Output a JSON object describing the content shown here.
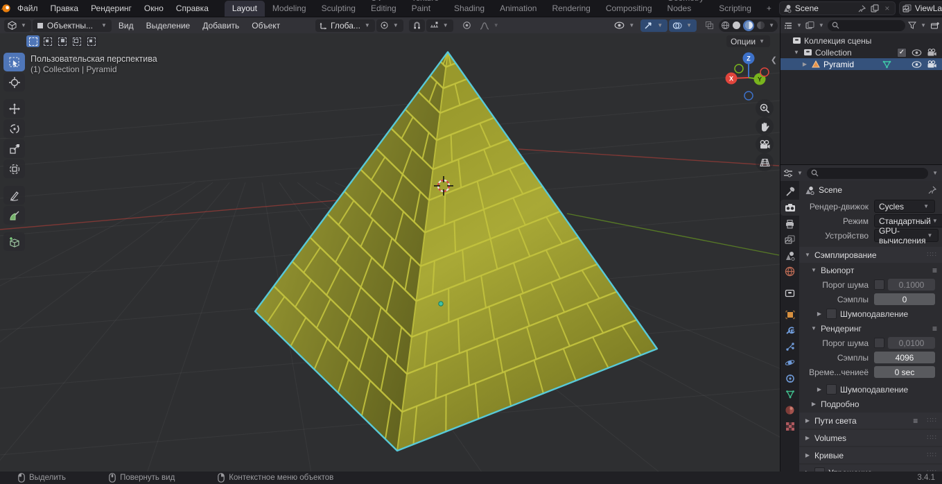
{
  "colors": {
    "accent": "#4f76b8",
    "selection_outline": "#58c9d8",
    "pyramid_mortar": "#c2c23e",
    "axis_x": "#e0453c",
    "axis_y": "#79b41e",
    "axis_z": "#3d71c9",
    "origin_dot": "#41c2a6"
  },
  "topbar": {
    "menus": [
      "Файл",
      "Правка",
      "Рендеринг",
      "Окно",
      "Справка"
    ],
    "tabs": [
      "Layout",
      "Modeling",
      "Sculpting",
      "UV Editing",
      "Texture Paint",
      "Shading",
      "Animation",
      "Rendering",
      "Compositing",
      "Geometry Nodes",
      "Scripting",
      "+"
    ],
    "active_tab": "Layout",
    "scene": "Scene",
    "viewlayer": "ViewLayer"
  },
  "header": {
    "mode": "Объектны...",
    "menus": [
      "Вид",
      "Выделение",
      "Добавить",
      "Объект"
    ],
    "orientation": "Глоба...",
    "options": "Опции"
  },
  "viewport": {
    "view_label": "Пользовательская перспектива",
    "context_label": "(1) Collection | Pyramid",
    "gizmo_axes": [
      "X",
      "Y",
      "Z"
    ]
  },
  "outliner": {
    "root_label": "Коллекция сцены",
    "collection_label": "Collection",
    "object_label": "Pyramid"
  },
  "properties": {
    "breadcrumb": "Scene",
    "render_engine_label": "Рендер-движок",
    "render_engine": "Cycles",
    "feature_set_label": "Режим",
    "feature_set": "Стандартный",
    "device_label": "Устройство",
    "device": "GPU-вычисления",
    "sampling": {
      "title": "Сэмплирование",
      "viewport": {
        "title": "Вьюпорт",
        "noise_label": "Порог шума",
        "noise_value": "0.1000",
        "samples_label": "Сэмплы",
        "samples_value": "0",
        "denoise_label": "Шумоподавление"
      },
      "render": {
        "title": "Рендеринг",
        "noise_label": "Порог шума",
        "noise_value": "0,0100",
        "samples_label": "Сэмплы",
        "samples_value": "4096",
        "time_label": "Време...чениеё",
        "time_value": "0 sec",
        "denoise_label": "Шумоподавление"
      },
      "advanced_label": "Подробно"
    },
    "sections": [
      "Пути света",
      "Volumes",
      "Кривые",
      "Упрощение"
    ]
  },
  "statusbar": {
    "items": [
      "Выделить",
      "Повернуть вид",
      "Контекстное меню объектов"
    ],
    "version": "3.4.1"
  }
}
